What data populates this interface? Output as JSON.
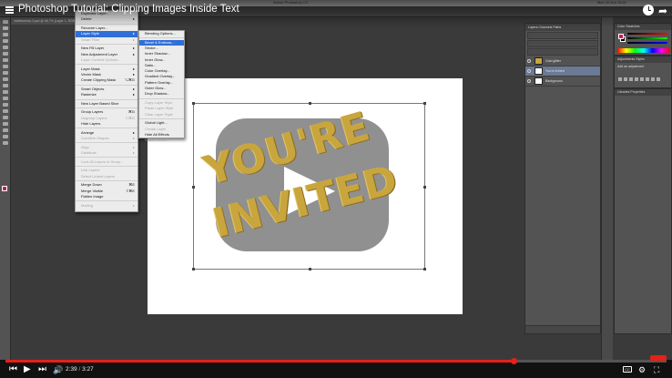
{
  "video": {
    "title": "Photoshop Tutorial: Clipping Images Inside Text",
    "current_time": "2:39",
    "duration": "3:27",
    "time_separator": "/",
    "progress_fraction": 0.768,
    "cc_label": "CC"
  },
  "photoshop": {
    "app_title": "Adobe Photoshop CC",
    "clock": "Mon 10 Jun  13:41",
    "document_tab": "invitetutorial-3.psd @ 66.7% (Layer 1, RGB/8)",
    "canvas_text_line1": "YOU'RE",
    "canvas_text_line2": "INVITED",
    "layers_tabs": "Layers  Channels  Paths",
    "layers": [
      {
        "name": "Gold glitter",
        "active": false
      },
      {
        "name": "You're invited",
        "active": true
      },
      {
        "name": "Background",
        "active": false
      }
    ],
    "color_tabs": "Color  Swatches",
    "adjustments_tabs": "Adjustments  Styles",
    "adjustments_sub": "Add an adjustment",
    "libraries_tabs": "Libraries  Properties"
  },
  "layer_menu": [
    {
      "label": "Duplicate Layer...",
      "shortcut": ""
    },
    {
      "label": "Delete",
      "shortcut": "▸"
    },
    {
      "sep": true
    },
    {
      "label": "Rename Layer...",
      "shortcut": ""
    },
    {
      "label": "Layer Style",
      "shortcut": "▸",
      "selected": true
    },
    {
      "label": "Smart Filter",
      "shortcut": "▸",
      "disabled": true
    },
    {
      "sep": true
    },
    {
      "label": "New Fill Layer",
      "shortcut": "▸"
    },
    {
      "label": "New Adjustment Layer",
      "shortcut": "▸"
    },
    {
      "label": "Layer Content Options...",
      "shortcut": "",
      "disabled": true
    },
    {
      "sep": true
    },
    {
      "label": "Layer Mask",
      "shortcut": "▸"
    },
    {
      "label": "Vector Mask",
      "shortcut": "▸"
    },
    {
      "label": "Create Clipping Mask",
      "shortcut": "⌥⌘G"
    },
    {
      "sep": true
    },
    {
      "label": "Smart Objects",
      "shortcut": "▸"
    },
    {
      "label": "Rasterize",
      "shortcut": "▸"
    },
    {
      "sep": true
    },
    {
      "label": "New Layer Based Slice",
      "shortcut": ""
    },
    {
      "sep": true
    },
    {
      "label": "Group Layers",
      "shortcut": "⌘G"
    },
    {
      "label": "Ungroup Layers",
      "shortcut": "⇧⌘G",
      "disabled": true
    },
    {
      "label": "Hide Layers",
      "shortcut": ""
    },
    {
      "sep": true
    },
    {
      "label": "Arrange",
      "shortcut": "▸"
    },
    {
      "label": "Combine Shapes",
      "shortcut": "▸",
      "disabled": true
    },
    {
      "sep": true
    },
    {
      "label": "Align",
      "shortcut": "▸",
      "disabled": true
    },
    {
      "label": "Distribute",
      "shortcut": "▸",
      "disabled": true
    },
    {
      "sep": true
    },
    {
      "label": "Lock All Layers in Group...",
      "shortcut": "",
      "disabled": true
    },
    {
      "sep": true
    },
    {
      "label": "Link Layers",
      "shortcut": "",
      "disabled": true
    },
    {
      "label": "Select Linked Layers",
      "shortcut": "",
      "disabled": true
    },
    {
      "sep": true
    },
    {
      "label": "Merge Down",
      "shortcut": "⌘E"
    },
    {
      "label": "Merge Visible",
      "shortcut": "⇧⌘E"
    },
    {
      "label": "Flatten Image",
      "shortcut": ""
    },
    {
      "sep": true
    },
    {
      "label": "Matting",
      "shortcut": "▸",
      "disabled": true
    }
  ],
  "style_menu": [
    {
      "label": "Blending Options...",
      "shortcut": ""
    },
    {
      "sep": true
    },
    {
      "label": "Bevel & Emboss...",
      "shortcut": "",
      "selected": true
    },
    {
      "label": "Stroke...",
      "shortcut": ""
    },
    {
      "label": "Inner Shadow...",
      "shortcut": ""
    },
    {
      "label": "Inner Glow...",
      "shortcut": ""
    },
    {
      "label": "Satin...",
      "shortcut": ""
    },
    {
      "label": "Color Overlay...",
      "shortcut": ""
    },
    {
      "label": "Gradient Overlay...",
      "shortcut": ""
    },
    {
      "label": "Pattern Overlay...",
      "shortcut": ""
    },
    {
      "label": "Outer Glow...",
      "shortcut": ""
    },
    {
      "label": "Drop Shadow...",
      "shortcut": ""
    },
    {
      "sep": true
    },
    {
      "label": "Copy Layer Style",
      "shortcut": "",
      "disabled": true
    },
    {
      "label": "Paste Layer Style",
      "shortcut": "",
      "disabled": true
    },
    {
      "label": "Clear Layer Style",
      "shortcut": "",
      "disabled": true
    },
    {
      "sep": true
    },
    {
      "label": "Global Light...",
      "shortcut": ""
    },
    {
      "label": "Create Layer",
      "shortcut": "",
      "disabled": true
    },
    {
      "label": "Hide All Effects",
      "shortcut": ""
    },
    {
      "label": "Scale Effects...",
      "shortcut": "",
      "disabled": true
    }
  ],
  "colors": {
    "accent_red": "#e62117",
    "foreground_swatch": "#d4145a",
    "menu_highlight": "#2f6fd7",
    "gold": "#c9a53e"
  }
}
